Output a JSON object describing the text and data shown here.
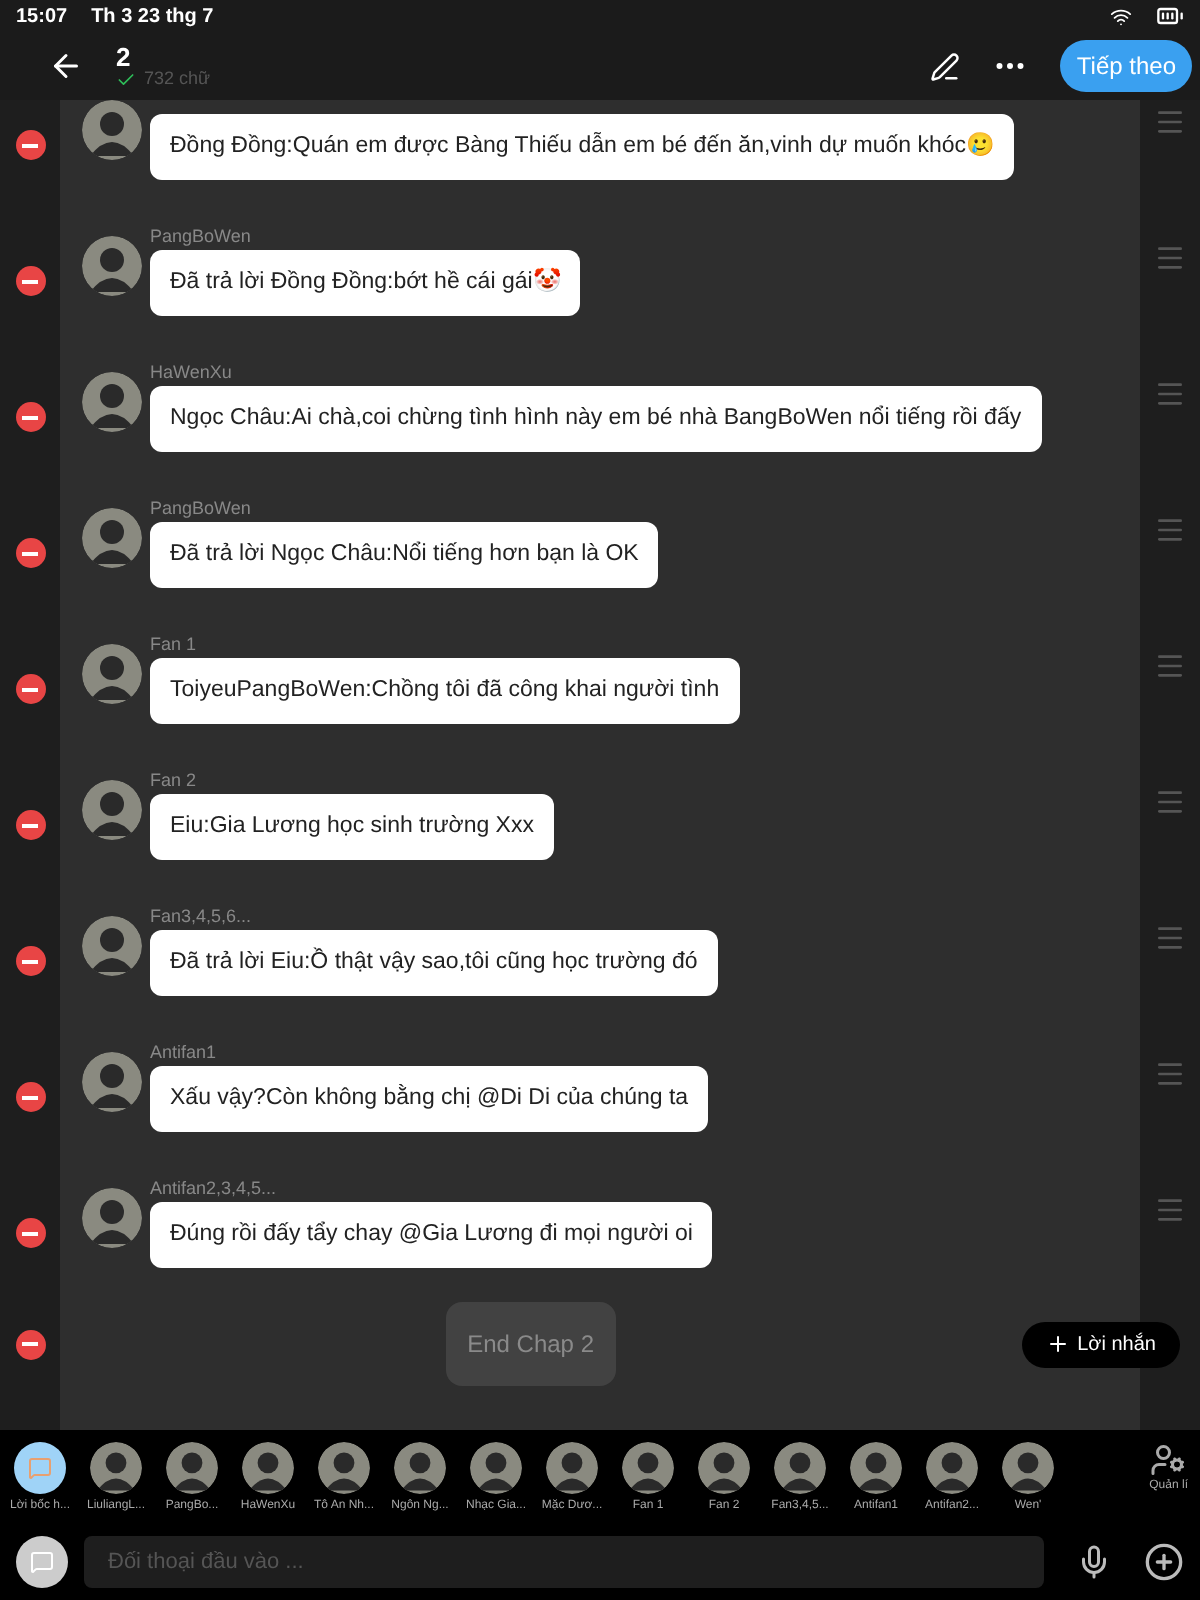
{
  "status_bar": {
    "time": "15:07",
    "date": "Th 3 23 thg 7"
  },
  "header": {
    "title": "2",
    "word_count": "732 chữ",
    "next_button": "Tiếp theo"
  },
  "messages": [
    {
      "text": "Đồng Đồng:Quán em được Bàng Thiếu dẫn em bé đến ăn,vinh dự muốn khóc🥲"
    },
    {
      "name": "PangBoWen",
      "text": "Đã trả lời Đồng Đồng:bớt hề cái gái🤡"
    },
    {
      "name": "HaWenXu",
      "text": "Ngọc Châu:Ai chà,coi chừng tình hình này em bé nhà BangBoWen nổi tiếng rồi đấy"
    },
    {
      "name": "PangBoWen",
      "text": "Đã trả lời Ngọc Châu:Nổi tiếng hơn bạn là OK"
    },
    {
      "name": "Fan 1",
      "text": "ToiyeuPangBoWen:Chồng tôi đã công khai người tình"
    },
    {
      "name": "Fan 2",
      "text": "Eiu:Gia Lương học sinh trường Xxx"
    },
    {
      "name": "Fan3,4,5,6...",
      "text": "Đã trả lời Eiu:Ồ thật vậy sao,tôi cũng học trường đó"
    },
    {
      "name": "Antifan1",
      "text": "Xấu vậy?Còn không bằng chị @Di Di của chúng ta"
    },
    {
      "name": "Antifan2,3,4,5...",
      "text": "Đúng rồi đấy tẩy chay @Gia Lương đi mọi người oi"
    }
  ],
  "narration": {
    "text": "End Chap 2"
  },
  "add_message_button": "Lời nhắn",
  "characters": [
    {
      "kind": "narrator",
      "name": "Lời bốc h..."
    },
    {
      "kind": "avatar",
      "name": "LiuliangL..."
    },
    {
      "kind": "avatar",
      "name": "PangBo..."
    },
    {
      "kind": "avatar",
      "name": "HaWenXu"
    },
    {
      "kind": "avatar",
      "name": "Tô An Nh..."
    },
    {
      "kind": "avatar",
      "name": "Ngôn Ng..."
    },
    {
      "kind": "avatar",
      "name": "Nhạc Gia..."
    },
    {
      "kind": "avatar",
      "name": "Mặc Dươ..."
    },
    {
      "kind": "avatar",
      "name": "Fan 1"
    },
    {
      "kind": "avatar",
      "name": "Fan 2"
    },
    {
      "kind": "avatar",
      "name": "Fan3,4,5..."
    },
    {
      "kind": "avatar",
      "name": "Antifan1"
    },
    {
      "kind": "avatar",
      "name": "Antifan2..."
    },
    {
      "kind": "avatar",
      "name": "Wen'"
    }
  ],
  "manage_button": "Quản lí",
  "input": {
    "placeholder": "Đối thoại đầu vào ..."
  }
}
